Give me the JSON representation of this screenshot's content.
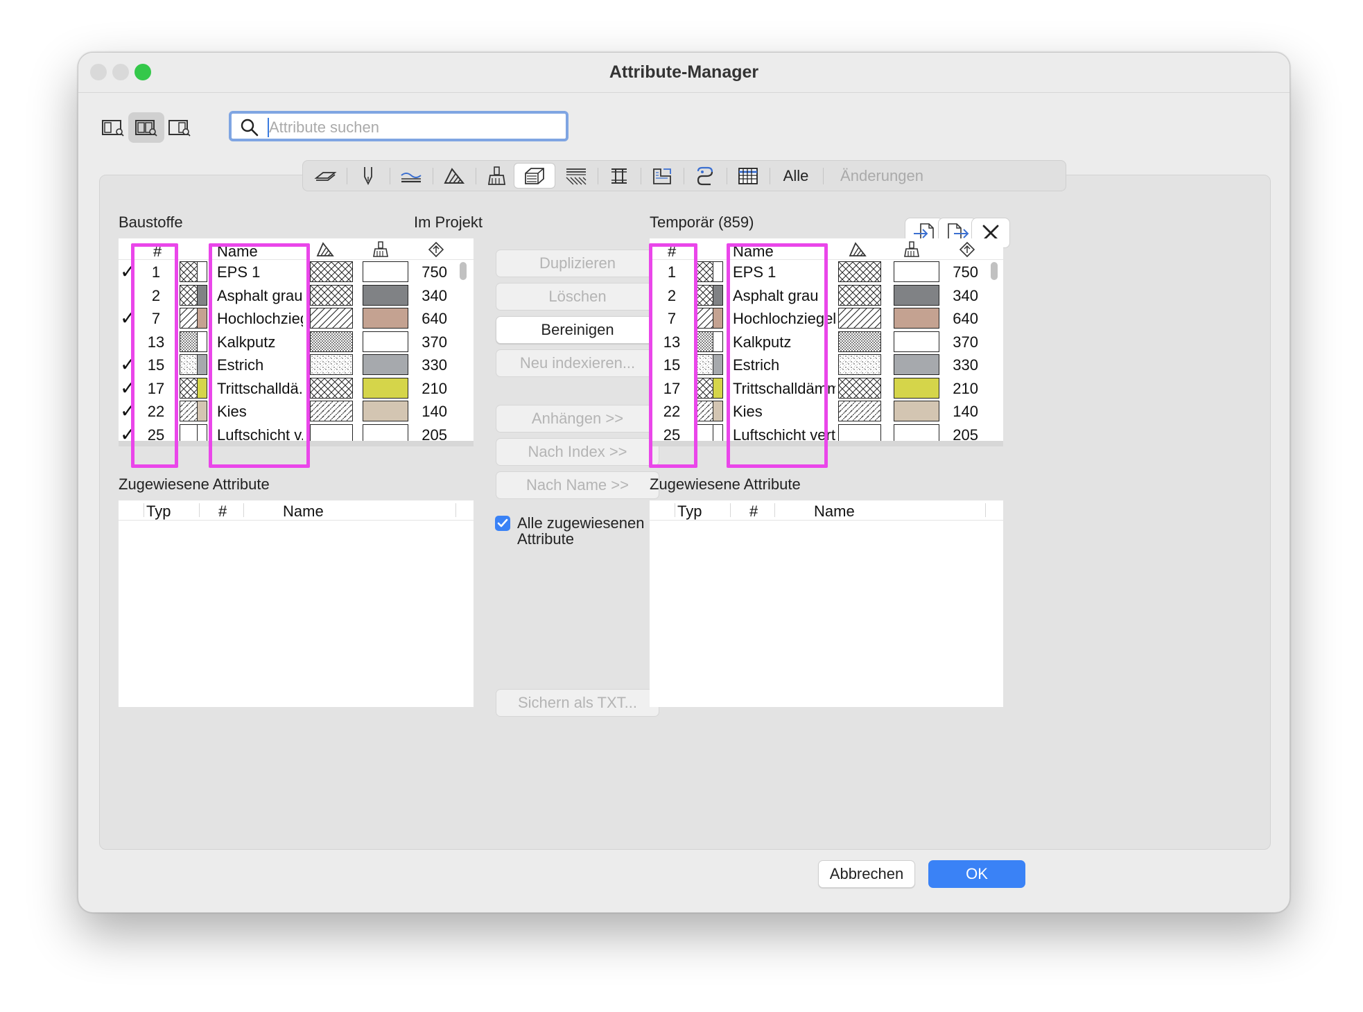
{
  "window": {
    "title": "Attribute-Manager",
    "traffic_colors": [
      "#d9d9d9",
      "#d9d9d9",
      "#34c84a"
    ]
  },
  "toolbar": {
    "view_buttons": [
      "left-view-icon",
      "both-views-icon",
      "right-view-icon"
    ],
    "search": {
      "placeholder": "Attribute suchen",
      "value": ""
    }
  },
  "tabs": {
    "icons": [
      "layer-icon",
      "pen-icon",
      "line-type-icon",
      "fill-icon",
      "surface-icon",
      "building-material-icon",
      "composite-icon",
      "profile-icon",
      "zone-category-icon",
      "mep-system-icon",
      "grid-icon"
    ],
    "selected_index": 5,
    "all_label": "Alle",
    "changes_label": "Änderungen"
  },
  "left": {
    "title": "Baustoffe",
    "context": "Im Projekt",
    "columns": {
      "index": "#",
      "name": "Name"
    },
    "rows": [
      {
        "checked": true,
        "index": "1",
        "name": "EPS 1",
        "value": "750",
        "pattern": "cross",
        "color": "#ffffff"
      },
      {
        "checked": false,
        "index": "2",
        "name": "Asphalt grau",
        "value": "340",
        "pattern": "cross",
        "color": "#808285"
      },
      {
        "checked": true,
        "index": "7",
        "name": "Hochlochziegel",
        "value": "640",
        "pattern": "diag",
        "color": "#c4a291"
      },
      {
        "checked": false,
        "index": "13",
        "name": "Kalkputz",
        "value": "370",
        "pattern": "dots",
        "color": "#ffffff"
      },
      {
        "checked": true,
        "index": "15",
        "name": "Estrich",
        "value": "330",
        "pattern": "speckle",
        "color": "#a6a9ad"
      },
      {
        "checked": true,
        "index": "17",
        "name": "Trittschalldä...",
        "value": "210",
        "pattern": "cross",
        "color": "#d5d54a"
      },
      {
        "checked": true,
        "index": "22",
        "name": "Kies",
        "value": "140",
        "pattern": "gravel",
        "color": "#d3c5b2"
      },
      {
        "checked": true,
        "index": "25",
        "name": "Luftschicht v...",
        "value": "205",
        "pattern": "none",
        "color": "#ffffff"
      }
    ],
    "assigned": {
      "title": "Zugewiesene Attribute",
      "columns": {
        "type": "Typ",
        "index": "#",
        "name": "Name"
      }
    }
  },
  "right": {
    "title": "Temporär (859)",
    "columns": {
      "index": "#",
      "name": "Name"
    },
    "rows": [
      {
        "index": "1",
        "name": "EPS 1",
        "value": "750",
        "pattern": "cross",
        "color": "#ffffff"
      },
      {
        "index": "2",
        "name": "Asphalt grau",
        "value": "340",
        "pattern": "cross",
        "color": "#808285"
      },
      {
        "index": "7",
        "name": "Hochlochziegel",
        "value": "640",
        "pattern": "diag",
        "color": "#c4a291"
      },
      {
        "index": "13",
        "name": "Kalkputz",
        "value": "370",
        "pattern": "dots",
        "color": "#ffffff"
      },
      {
        "index": "15",
        "name": "Estrich",
        "value": "330",
        "pattern": "speckle",
        "color": "#a6a9ad"
      },
      {
        "index": "17",
        "name": "Trittschalldämm...",
        "value": "210",
        "pattern": "cross",
        "color": "#d5d54a"
      },
      {
        "index": "22",
        "name": "Kies",
        "value": "140",
        "pattern": "gravel",
        "color": "#d3c5b2"
      },
      {
        "index": "25",
        "name": "Luftschicht vert...",
        "value": "205",
        "pattern": "none",
        "color": "#ffffff"
      }
    ],
    "assigned": {
      "title": "Zugewiesene Attribute",
      "columns": {
        "type": "Typ",
        "index": "#",
        "name": "Name"
      }
    }
  },
  "middle": {
    "buttons": [
      {
        "label": "Duplizieren",
        "enabled": false
      },
      {
        "label": "Löschen",
        "enabled": false
      },
      {
        "label": "Bereinigen",
        "enabled": true
      },
      {
        "label": "Neu indexieren...",
        "enabled": false
      },
      {
        "label": "Anhängen >>",
        "enabled": false
      },
      {
        "label": "Nach Index >>",
        "enabled": false
      },
      {
        "label": "Nach Name >>",
        "enabled": false
      }
    ],
    "all_assigned": {
      "checked": true,
      "line1": "Alle zugewiesenen",
      "line2": "Attribute"
    },
    "save_txt": {
      "label": "Sichern als TXT...",
      "enabled": false
    }
  },
  "footer": {
    "cancel": "Abbrechen",
    "ok": "OK"
  },
  "colors": {
    "highlight": "#ea46ea",
    "accent": "#3a82f6"
  }
}
